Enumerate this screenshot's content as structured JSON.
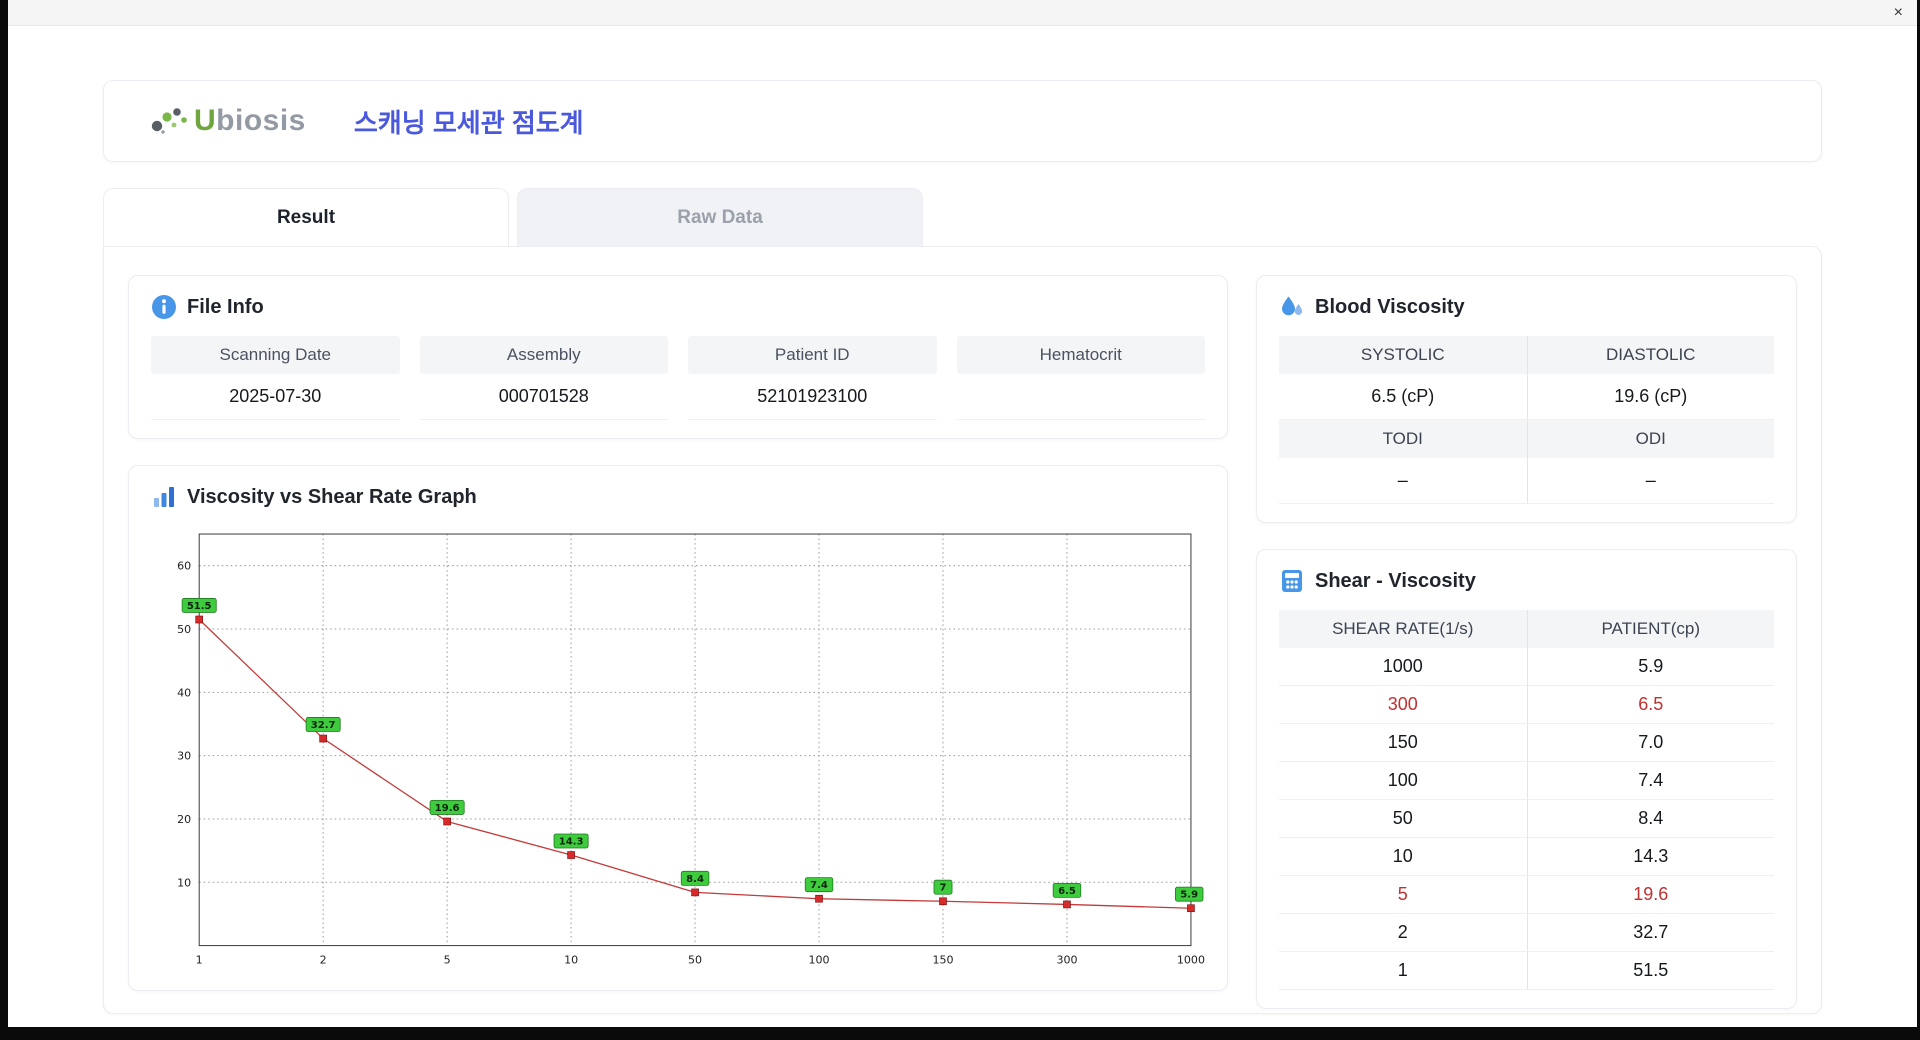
{
  "window": {
    "close_glyph": "×"
  },
  "theme": {
    "accent_blue": "#4a58dc",
    "icon_blue": "#4796e8",
    "panel_header_bg": "#f4f5f7",
    "highlight_red": "#c13030",
    "border": "#ebedf2"
  },
  "header": {
    "brand_u": "U",
    "brand_rest": "biosis",
    "title": "스캐닝 모세관 점도계"
  },
  "tabs": [
    {
      "label": "Result"
    },
    {
      "label": "Raw Data"
    }
  ],
  "file_info": {
    "heading": "File Info",
    "fields": [
      {
        "label": "Scanning Date",
        "value": "2025-07-30"
      },
      {
        "label": "Assembly",
        "value": "000701528"
      },
      {
        "label": "Patient ID",
        "value": "52101923100"
      },
      {
        "label": "Hematocrit",
        "value": ""
      }
    ]
  },
  "graph": {
    "heading": "Viscosity vs Shear Rate Graph"
  },
  "blood_viscosity": {
    "heading": "Blood Viscosity",
    "pairs": [
      {
        "label": "SYSTOLIC",
        "value": "6.5 (cP)"
      },
      {
        "label": "DIASTOLIC",
        "value": "19.6 (cP)"
      },
      {
        "label": "TODI",
        "value": "–"
      },
      {
        "label": "ODI",
        "value": "–"
      }
    ]
  },
  "shear_viscosity": {
    "heading": "Shear - Viscosity",
    "columns": [
      "SHEAR RATE(1/s)",
      "PATIENT(cp)"
    ],
    "rows": [
      {
        "shear_rate": "1000",
        "patient": "5.9",
        "highlight": false
      },
      {
        "shear_rate": "300",
        "patient": "6.5",
        "highlight": true
      },
      {
        "shear_rate": "150",
        "patient": "7.0",
        "highlight": false
      },
      {
        "shear_rate": "100",
        "patient": "7.4",
        "highlight": false
      },
      {
        "shear_rate": "50",
        "patient": "8.4",
        "highlight": false
      },
      {
        "shear_rate": "10",
        "patient": "14.3",
        "highlight": false
      },
      {
        "shear_rate": "5",
        "patient": "19.6",
        "highlight": true
      },
      {
        "shear_rate": "2",
        "patient": "32.7",
        "highlight": false
      },
      {
        "shear_rate": "1",
        "patient": "51.5",
        "highlight": false
      }
    ]
  },
  "chart_data": {
    "type": "line",
    "title": "Viscosity vs Shear Rate Graph",
    "x_ticks": [
      "1",
      "2",
      "5",
      "10",
      "50",
      "100",
      "150",
      "300",
      "1000"
    ],
    "x": [
      1,
      2,
      5,
      10,
      50,
      100,
      150,
      300,
      1000
    ],
    "values": [
      51.5,
      32.7,
      19.6,
      14.3,
      8.4,
      7.4,
      7,
      6.5,
      5.9
    ],
    "point_labels": [
      "51.5",
      "32.7",
      "19.6",
      "14.3",
      "8.4",
      "7.4",
      "7",
      "6.5",
      "5.9"
    ],
    "y_ticks": [
      10,
      20,
      30,
      40,
      50,
      60
    ],
    "ylim": [
      0,
      65
    ],
    "x_scale": "equally-spaced-ticks",
    "grid": "dotted",
    "legend": "none",
    "line_color": "#c43a3a",
    "marker_color": "#d62b2b",
    "marker_border": "#7a0b0b",
    "point_label_bg": "#3ecc3e",
    "point_label_border": "#1f7a1f"
  }
}
